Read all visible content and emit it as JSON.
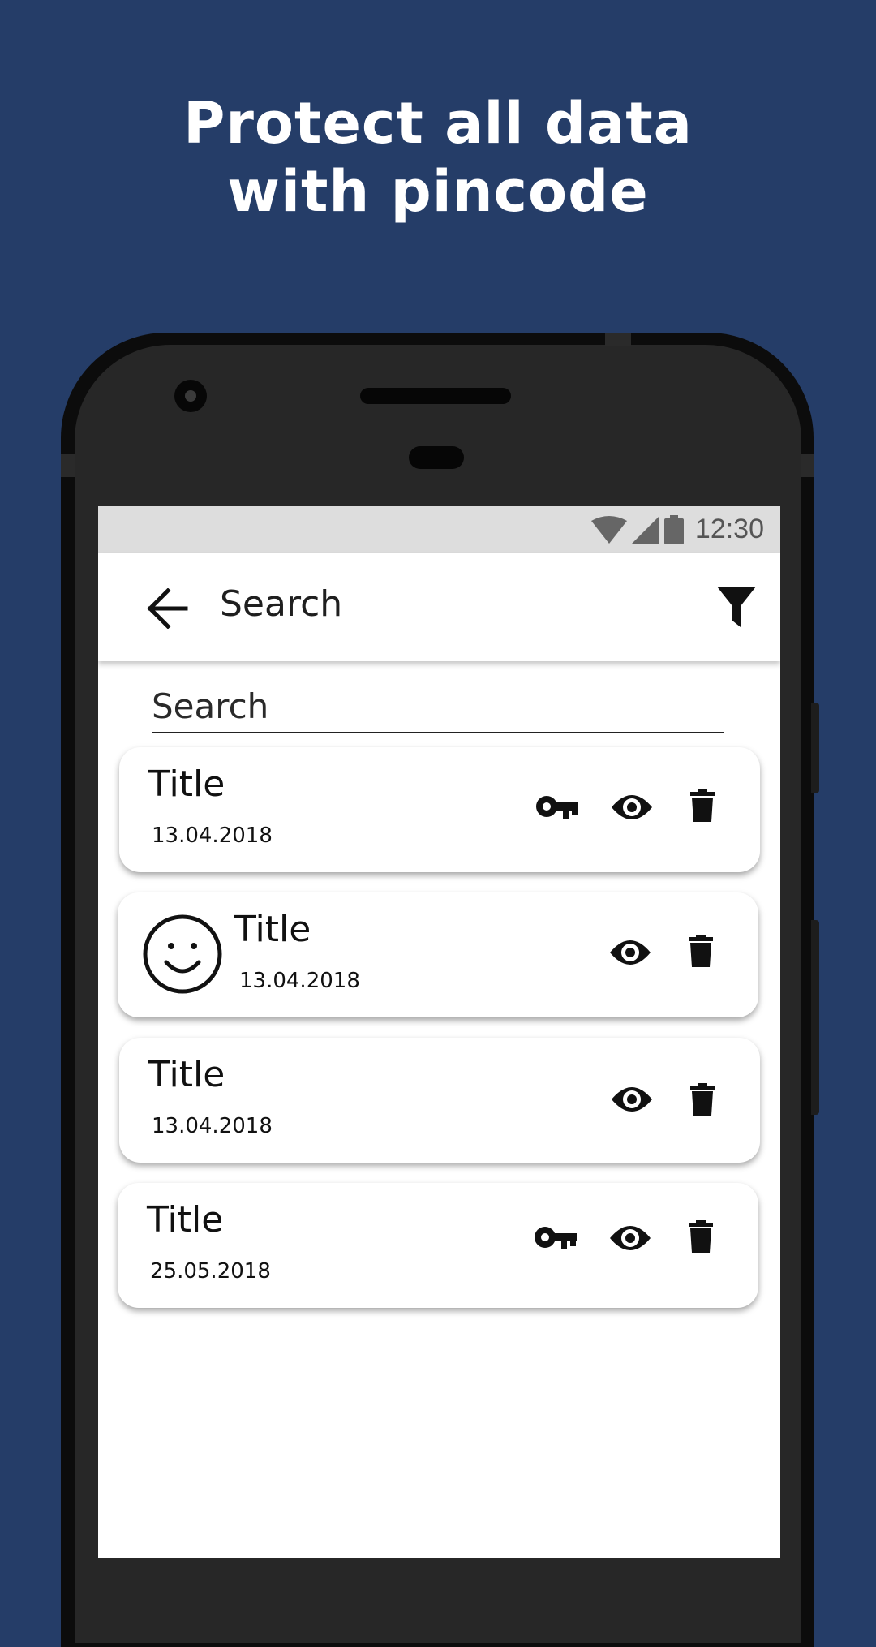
{
  "headline": {
    "line1": "Protect all data",
    "line2": "with pincode"
  },
  "statusbar": {
    "time": "12:30"
  },
  "appbar": {
    "title": "Search",
    "back_icon": "arrow-left-icon",
    "filter_icon": "filter-icon"
  },
  "search": {
    "placeholder": "Search"
  },
  "items": [
    {
      "title": "Title",
      "date": "13.04.2018",
      "has_key": true,
      "has_avatar": false
    },
    {
      "title": "Title",
      "date": "13.04.2018",
      "has_key": false,
      "has_avatar": true
    },
    {
      "title": "Title",
      "date": "13.04.2018",
      "has_key": false,
      "has_avatar": false
    },
    {
      "title": "Title",
      "date": "25.05.2018",
      "has_key": true,
      "has_avatar": false
    }
  ],
  "colors": {
    "background": "#253d68",
    "headline": "#ffffff",
    "screen": "#ffffff",
    "statusbar": "#dddddd"
  }
}
